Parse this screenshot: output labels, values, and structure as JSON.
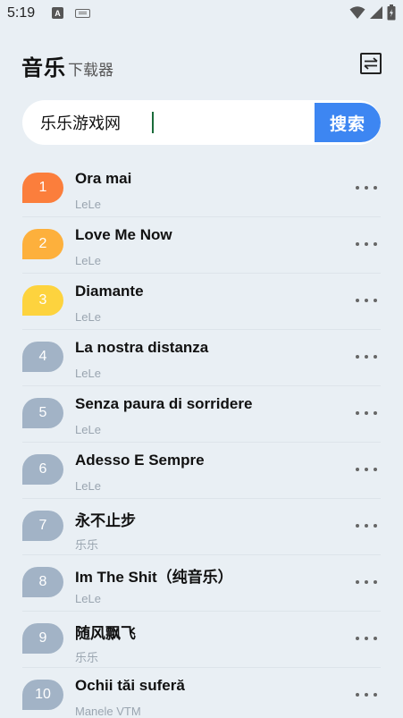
{
  "status_bar": {
    "time": "5:19",
    "icons": [
      "a-notification-icon",
      "keyboard-icon",
      "wifi-icon",
      "signal-icon",
      "battery-icon"
    ]
  },
  "header": {
    "title": "音乐",
    "subtitle": "下载器",
    "switch_icon": "swap-icon"
  },
  "search": {
    "value": "乐乐游戏网",
    "button_label": "搜索"
  },
  "colors": {
    "rank_1": "#fb7e3c",
    "rank_2": "#fdb03c",
    "rank_3": "#fdd33e",
    "rank_other": "#a2b3c6",
    "search_button": "#3d86f2"
  },
  "songs": [
    {
      "rank": "1",
      "title": "Ora mai",
      "artist": "LeLe"
    },
    {
      "rank": "2",
      "title": "Love Me Now",
      "artist": "LeLe"
    },
    {
      "rank": "3",
      "title": "Diamante",
      "artist": "LeLe"
    },
    {
      "rank": "4",
      "title": "La nostra distanza",
      "artist": "LeLe"
    },
    {
      "rank": "5",
      "title": "Senza paura di sorridere",
      "artist": "LeLe"
    },
    {
      "rank": "6",
      "title": "Adesso E Sempre",
      "artist": "LeLe"
    },
    {
      "rank": "7",
      "title": "永不止步",
      "artist": "乐乐"
    },
    {
      "rank": "8",
      "title": "Im The Shit（纯音乐）",
      "artist": "LeLe"
    },
    {
      "rank": "9",
      "title": "随风飘飞",
      "artist": "乐乐"
    },
    {
      "rank": "10",
      "title": "Ochii tăi suferă",
      "artist": "Manele VTM"
    }
  ]
}
